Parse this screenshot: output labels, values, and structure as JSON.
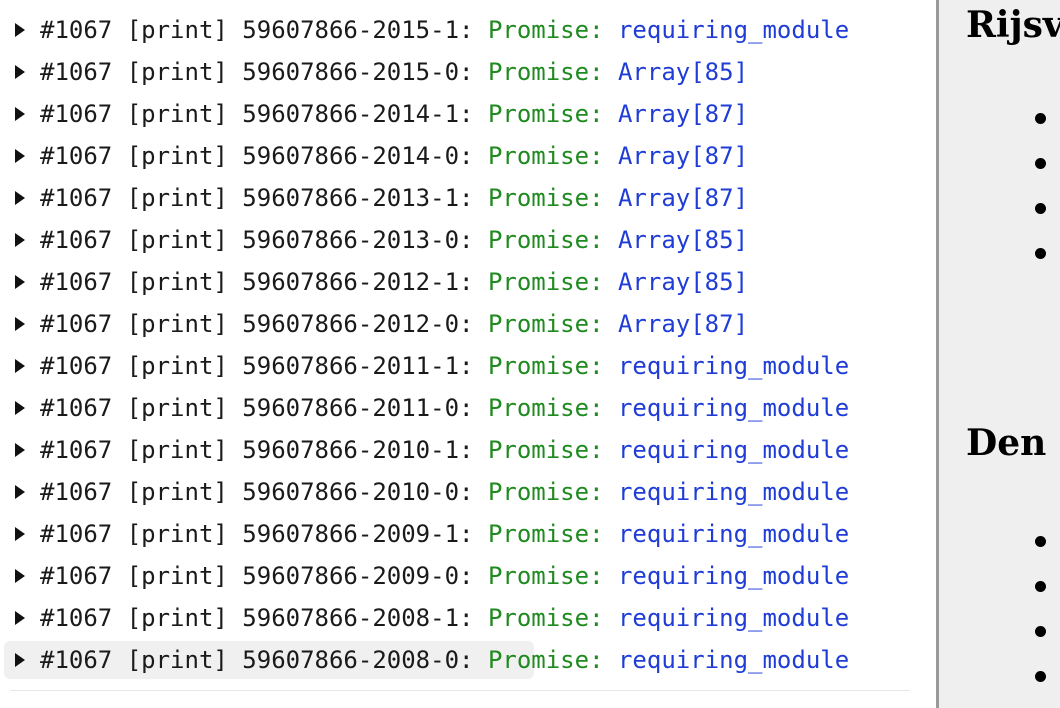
{
  "console": {
    "rows": [
      {
        "prefix": "#1067 [print] 59607866-2015-1:",
        "type": "Promise:",
        "value": "requiring_module"
      },
      {
        "prefix": "#1067 [print] 59607866-2015-0:",
        "type": "Promise:",
        "value": "Array[85]"
      },
      {
        "prefix": "#1067 [print] 59607866-2014-1:",
        "type": "Promise:",
        "value": "Array[87]"
      },
      {
        "prefix": "#1067 [print] 59607866-2014-0:",
        "type": "Promise:",
        "value": "Array[87]"
      },
      {
        "prefix": "#1067 [print] 59607866-2013-1:",
        "type": "Promise:",
        "value": "Array[87]"
      },
      {
        "prefix": "#1067 [print] 59607866-2013-0:",
        "type": "Promise:",
        "value": "Array[85]"
      },
      {
        "prefix": "#1067 [print] 59607866-2012-1:",
        "type": "Promise:",
        "value": "Array[85]"
      },
      {
        "prefix": "#1067 [print] 59607866-2012-0:",
        "type": "Promise:",
        "value": "Array[87]"
      },
      {
        "prefix": "#1067 [print] 59607866-2011-1:",
        "type": "Promise:",
        "value": "requiring_module"
      },
      {
        "prefix": "#1067 [print] 59607866-2011-0:",
        "type": "Promise:",
        "value": "requiring_module"
      },
      {
        "prefix": "#1067 [print] 59607866-2010-1:",
        "type": "Promise:",
        "value": "requiring_module"
      },
      {
        "prefix": "#1067 [print] 59607866-2010-0:",
        "type": "Promise:",
        "value": "requiring_module"
      },
      {
        "prefix": "#1067 [print] 59607866-2009-1:",
        "type": "Promise:",
        "value": "requiring_module"
      },
      {
        "prefix": "#1067 [print] 59607866-2009-0:",
        "type": "Promise:",
        "value": "requiring_module"
      },
      {
        "prefix": "#1067 [print] 59607866-2008-1:",
        "type": "Promise:",
        "value": "requiring_module"
      },
      {
        "prefix": "#1067 [print] 59607866-2008-0:",
        "type": "Promise:",
        "value": "requiring_module"
      }
    ],
    "selected_row": 15,
    "colors": {
      "prefix": "#1a1a1a",
      "promise": "#1f8a1f",
      "value": "#1f3dd6"
    }
  },
  "page": {
    "headings": [
      "Rijsv",
      "Den "
    ],
    "bullet_groups": [
      4,
      4
    ]
  }
}
